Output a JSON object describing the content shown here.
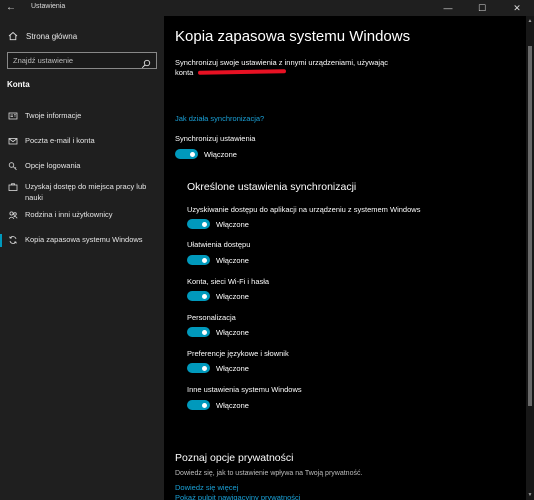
{
  "window": {
    "title": "Ustawienia",
    "back_glyph": "←",
    "minimize_glyph": "—",
    "maximize_glyph": "☐",
    "close_glyph": "✕"
  },
  "sidebar": {
    "home_label": "Strona główna",
    "search_placeholder": "Znajdź ustawienie",
    "section_heading": "Konta",
    "items": [
      {
        "label": "Twoje informacje",
        "icon": "person-card-icon"
      },
      {
        "label": "Poczta e-mail i konta",
        "icon": "mail-icon"
      },
      {
        "label": "Opcje logowania",
        "icon": "key-icon"
      },
      {
        "label": "Uzyskaj dostęp do miejsca pracy lub nauki",
        "icon": "briefcase-icon"
      },
      {
        "label": "Rodzina i inni użytkownicy",
        "icon": "people-icon"
      },
      {
        "label": "Kopia zapasowa systemu Windows",
        "icon": "sync-icon",
        "active": true
      }
    ]
  },
  "main": {
    "title": "Kopia zapasowa systemu Windows",
    "description_line1": "Synchronizuj swoje ustawienia z innymi urządzeniami, używając",
    "description_line2": "konta",
    "how_link": "Jak działa synchronizacja?",
    "sync_label": "Synchronizuj ustawienia",
    "sync_state": "Włączone",
    "subsection_title": "Określone ustawienia synchronizacji",
    "settings": [
      {
        "label": "Uzyskiwanie dostępu do aplikacji na urządzeniu z systemem Windows",
        "state": "Włączone"
      },
      {
        "label": "Ułatwienia dostępu",
        "state": "Włączone"
      },
      {
        "label": "Konta, sieci Wi-Fi i hasła",
        "state": "Włączone"
      },
      {
        "label": "Personalizacja",
        "state": "Włączone"
      },
      {
        "label": "Preferencje językowe i słownik",
        "state": "Włączone"
      },
      {
        "label": "Inne ustawienia systemu Windows",
        "state": "Włączone"
      }
    ],
    "privacy": {
      "title": "Poznaj opcje prywatności",
      "description": "Dowiedz się, jak to ustawienie wpływa na Twoją prywatność.",
      "link1": "Dowiedz się więcej",
      "link2": "Pokaż pulpit nawigacyjny prywatności"
    }
  },
  "colors": {
    "accent": "#0099bc",
    "link": "#1aa0d6",
    "redaction": "#e81123"
  }
}
